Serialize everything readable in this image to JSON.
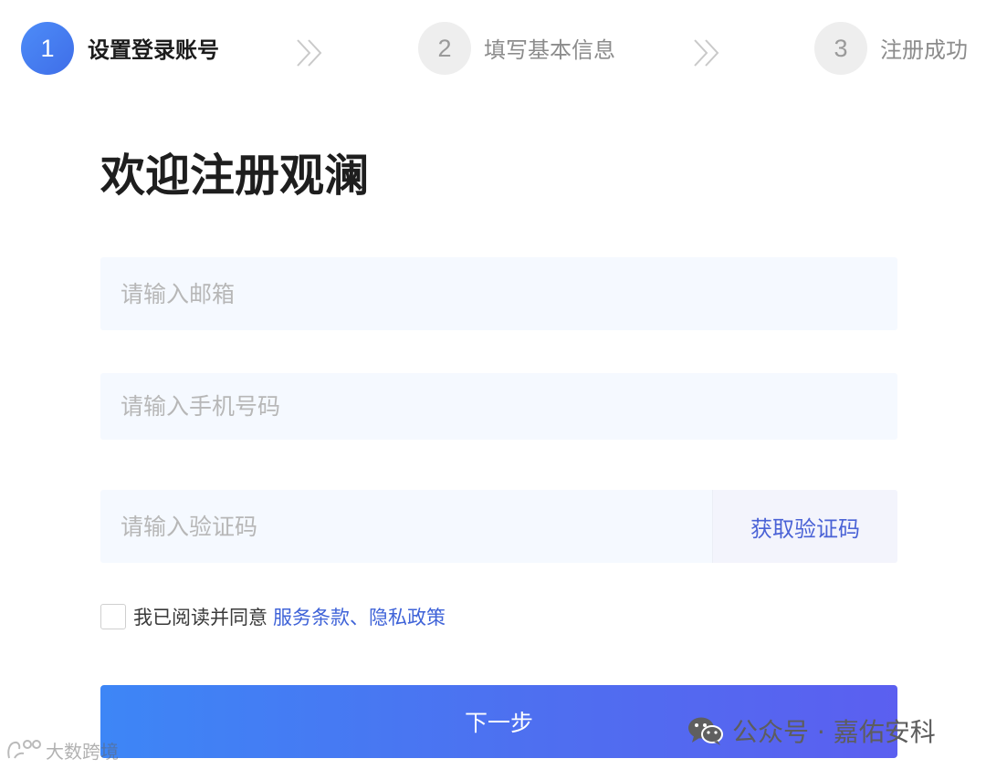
{
  "stepper": {
    "steps": [
      {
        "number": "1",
        "label": "设置登录账号",
        "state": "active"
      },
      {
        "number": "2",
        "label": "填写基本信息",
        "state": "inactive"
      },
      {
        "number": "3",
        "label": "注册成功",
        "state": "inactive"
      }
    ],
    "separator_icon": "double-chevron-right-icon"
  },
  "title": "欢迎注册观澜",
  "form": {
    "email": {
      "placeholder": "请输入邮箱",
      "value": ""
    },
    "phone": {
      "placeholder": "请输入手机号码",
      "value": ""
    },
    "code": {
      "placeholder": "请输入验证码",
      "value": "",
      "button_label": "获取验证码"
    },
    "agreement": {
      "checked": false,
      "text": "我已阅读并同意",
      "link": "服务条款、隐私政策"
    },
    "submit_label": "下一步"
  },
  "watermarks": {
    "left": {
      "text": "大数跨境",
      "icon": "hand-logo-icon"
    },
    "right": {
      "text": "公众号 · 嘉佑安科",
      "icon": "wechat-icon"
    }
  },
  "colors": {
    "accent": "#3f6ee8",
    "link": "#3f63d8",
    "input_bg": "#f5f9ff",
    "title": "#1e1e1e"
  }
}
